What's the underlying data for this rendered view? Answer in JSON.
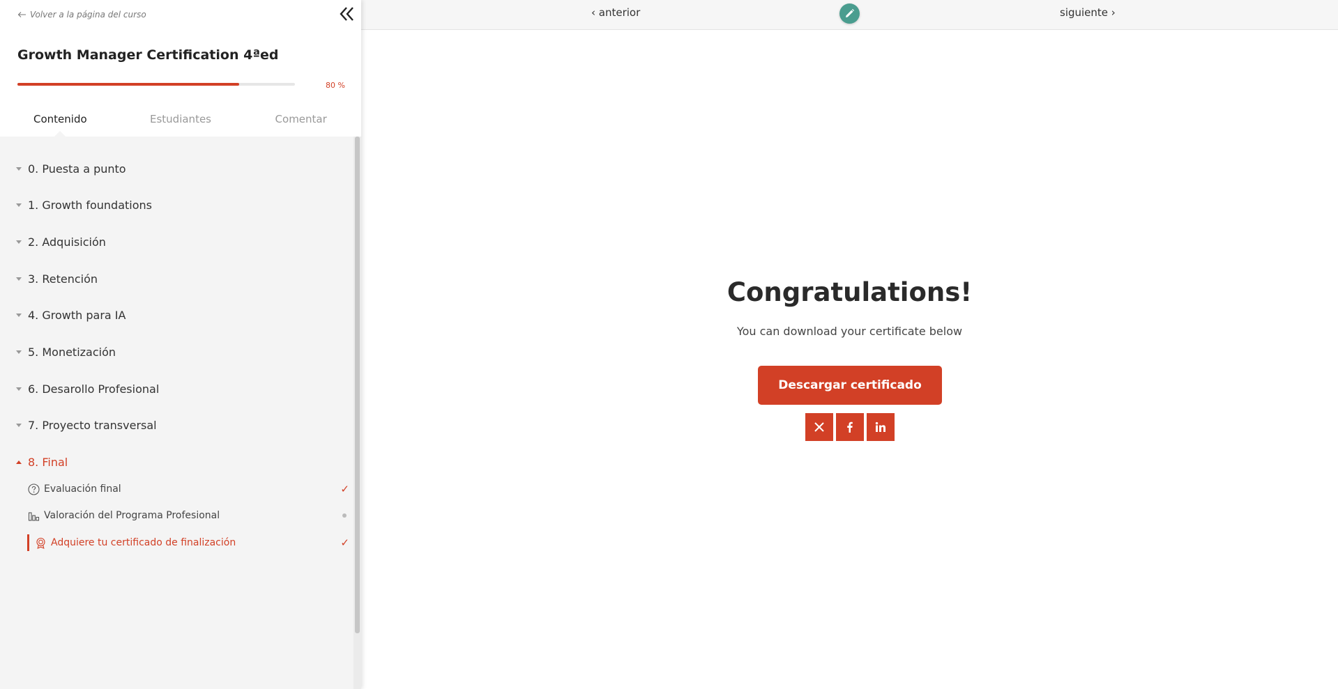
{
  "sidebar": {
    "back_label": "Volver a la página del curso",
    "course_title": "Growth Manager Certification 4ªed",
    "progress": {
      "percent": 80,
      "label": "80 %"
    },
    "tabs": [
      {
        "label": "Contenido",
        "active": true
      },
      {
        "label": "Estudiantes",
        "active": false
      },
      {
        "label": "Comentar",
        "active": false
      }
    ],
    "sections": [
      {
        "label": "0. Puesta a punto"
      },
      {
        "label": "1. Growth foundations"
      },
      {
        "label": "2. Adquisición"
      },
      {
        "label": "3. Retención"
      },
      {
        "label": "4. Growth para IA"
      },
      {
        "label": "5. Monetización"
      },
      {
        "label": "6. Desarollo Profesional"
      },
      {
        "label": "7. Proyecto transversal"
      },
      {
        "label": "8. Final",
        "open": true
      }
    ],
    "lessons": [
      {
        "label": "Evaluación final",
        "icon": "question-circle-icon",
        "status": "✓"
      },
      {
        "label": "Valoración del Programa Profesional",
        "icon": "bar-chart-icon",
        "status": "pending-dot"
      },
      {
        "label": "Adquiere tu certificado de finalización",
        "icon": "award-icon",
        "status": "✓",
        "current": true
      }
    ]
  },
  "topbar": {
    "prev_label": "‹ anterior",
    "next_label": "siguiente ›"
  },
  "content": {
    "heading": "Congratulations!",
    "subtext": "You can download your certificate below",
    "download_label": "Descargar certificado",
    "share": [
      "x-icon",
      "facebook-icon",
      "linkedin-icon"
    ]
  },
  "colors": {
    "accent": "#d24026",
    "edit_button": "#4a9d8f",
    "sidebar_bg": "#f4f4f4"
  }
}
